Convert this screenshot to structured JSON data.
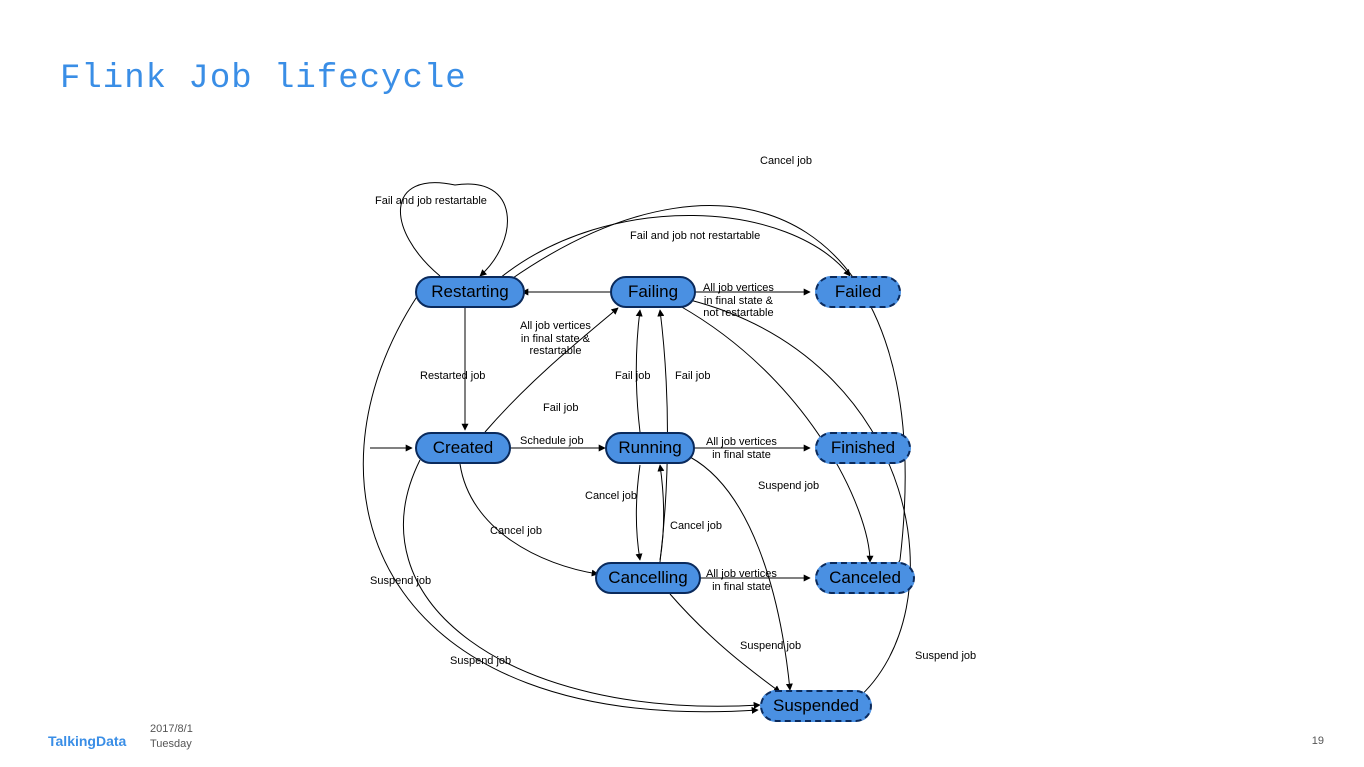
{
  "slide": {
    "title": "Flink Job lifecycle",
    "page_number": "19",
    "date": "2017/8/1",
    "day": "Tuesday",
    "logo_a": "Talking",
    "logo_b": "Data"
  },
  "nodes": {
    "restarting": "Restarting",
    "failing": "Failing",
    "failed": "Failed",
    "created": "Created",
    "running": "Running",
    "finished": "Finished",
    "cancelling": "Cancelling",
    "canceled": "Canceled",
    "suspended": "Suspended"
  },
  "edges": {
    "cancel_job_top": "Cancel job",
    "self_loop": "Fail and job restartable",
    "not_restartable": "Fail and job not restartable",
    "failing_to_failed_1": "All job vertices",
    "failing_to_failed_2": "in final state &",
    "failing_to_failed_3": "not restartable",
    "failing_to_restarting_1": "All job vertices",
    "failing_to_restarting_2": "in final state &",
    "failing_to_restarting_3": "restartable",
    "restarted": "Restarted job",
    "fail_job": "Fail job",
    "schedule": "Schedule job",
    "running_to_finished_1": "All job vertices",
    "running_to_finished_2": "in final state",
    "cancel_job": "Cancel job",
    "suspend_job": "Suspend job",
    "cancelling_to_canceled_1": "All job vertices",
    "cancelling_to_canceled_2": "in final state"
  },
  "chart_data": {
    "type": "state_diagram",
    "states": [
      {
        "id": "Restarting",
        "terminal": false
      },
      {
        "id": "Failing",
        "terminal": false
      },
      {
        "id": "Failed",
        "terminal": true
      },
      {
        "id": "Created",
        "terminal": false
      },
      {
        "id": "Running",
        "terminal": false
      },
      {
        "id": "Finished",
        "terminal": true
      },
      {
        "id": "Cancelling",
        "terminal": false
      },
      {
        "id": "Canceled",
        "terminal": true
      },
      {
        "id": "Suspended",
        "terminal": true
      }
    ],
    "initial_state": "Created",
    "transitions": [
      {
        "from": "Created",
        "to": "Running",
        "label": "Schedule job"
      },
      {
        "from": "Created",
        "to": "Failing",
        "label": "Fail job"
      },
      {
        "from": "Created",
        "to": "Cancelling",
        "label": "Cancel job"
      },
      {
        "from": "Created",
        "to": "Suspended",
        "label": "Suspend job"
      },
      {
        "from": "Running",
        "to": "Finished",
        "label": "All job vertices in final state"
      },
      {
        "from": "Running",
        "to": "Failing",
        "label": "Fail job"
      },
      {
        "from": "Running",
        "to": "Cancelling",
        "label": "Cancel job"
      },
      {
        "from": "Running",
        "to": "Suspended",
        "label": "Suspend job"
      },
      {
        "from": "Cancelling",
        "to": "Canceled",
        "label": "All job vertices in final state"
      },
      {
        "from": "Cancelling",
        "to": "Failing",
        "label": "Fail job"
      },
      {
        "from": "Cancelling",
        "to": "Suspended",
        "label": "Suspend job"
      },
      {
        "from": "Failing",
        "to": "Failed",
        "label": "All job vertices in final state & not restartable"
      },
      {
        "from": "Failing",
        "to": "Restarting",
        "label": "All job vertices in final state & restartable"
      },
      {
        "from": "Failing",
        "to": "Suspended",
        "label": "Suspend job"
      },
      {
        "from": "Failing",
        "to": "Canceled",
        "label": "Cancel job"
      },
      {
        "from": "Restarting",
        "to": "Created",
        "label": "Restarted job"
      },
      {
        "from": "Restarting",
        "to": "Restarting",
        "label": "Fail and job restartable"
      },
      {
        "from": "Restarting",
        "to": "Failed",
        "label": "Fail and job not restartable"
      },
      {
        "from": "Restarting",
        "to": "Suspended",
        "label": "Suspend job"
      },
      {
        "from": "Restarting",
        "to": "Canceled",
        "label": "Cancel job"
      }
    ]
  }
}
